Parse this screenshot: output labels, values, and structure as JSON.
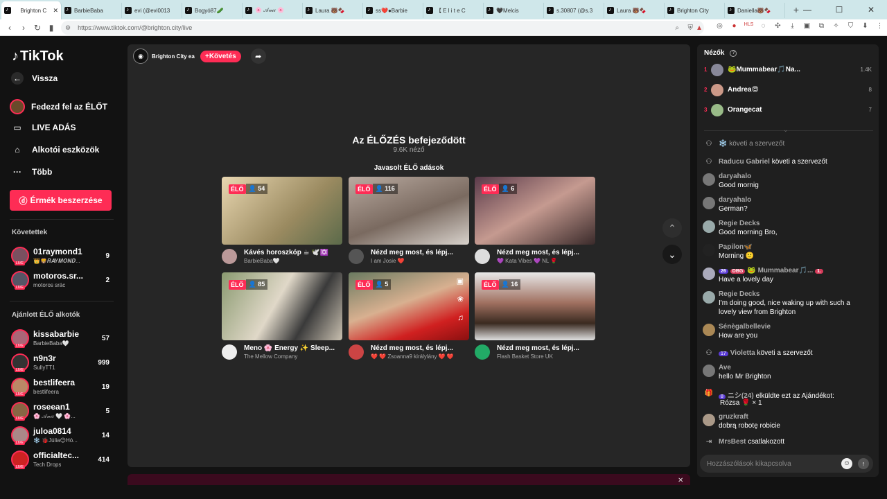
{
  "browser": {
    "tabs": [
      {
        "label": "Brighton C",
        "active": true
      },
      {
        "label": "BarbieBaba"
      },
      {
        "label": "evi (@evi0013"
      },
      {
        "label": "Bogyó87🥒"
      },
      {
        "label": "🌸 𝒜𝓃𝒾𝒾 🌸"
      },
      {
        "label": "Laura 🐻🍫"
      },
      {
        "label": "ss❤️●Barbie"
      },
      {
        "label": "【 E l i t e C"
      },
      {
        "label": "🖤Melcis"
      },
      {
        "label": "s.30807 (@s.3"
      },
      {
        "label": "Laura 🐻🍫"
      },
      {
        "label": "Brighton City"
      },
      {
        "label": "Daniella🐻🍫"
      }
    ],
    "url": "https://www.tiktok.com/@brighton.city/live",
    "new_tab": "+",
    "win_min": "—",
    "win_max": "☐",
    "win_close": "✕"
  },
  "sidebar": {
    "logo": "TikTok",
    "back": "Vissza",
    "nav": [
      {
        "label": "Fedezd fel az ÉLŐT",
        "icon": "explore-live-icon"
      },
      {
        "label": "LIVE ADÁS",
        "icon": "camera-icon"
      },
      {
        "label": "Alkotói eszközök",
        "icon": "creator-tools-icon"
      },
      {
        "label": "Több",
        "icon": "more-icon"
      }
    ],
    "coins_btn": "Érmék beszerzése",
    "following_title": "Követettek",
    "following": [
      {
        "name": "01raymond1",
        "sub": "👑🦁𝑹𝑨𝒀𝑴𝑶𝑵𝑫...",
        "count": "9"
      },
      {
        "name": "motoros.sr...",
        "sub": "motoros srác",
        "count": "2"
      }
    ],
    "recommended_title": "Ajánlott ÉLŐ alkotók",
    "recommended": [
      {
        "name": "kissabarbie",
        "sub": "BarbieBaba🤍",
        "count": "57"
      },
      {
        "name": "n9n3r",
        "sub": "SullyTT1",
        "count": "999"
      },
      {
        "name": "bestlifeera",
        "sub": "bestlifeera",
        "count": "19"
      },
      {
        "name": "roseean1",
        "sub": "🌸 𝒜𝓃𝒾𝒾 🤍 🌸...",
        "count": "5"
      },
      {
        "name": "juloa0814",
        "sub": "❄️ 🐞Júlia😊Hó...",
        "count": "14"
      },
      {
        "name": "officialtec...",
        "sub": "Tech Drops",
        "count": "414"
      }
    ]
  },
  "stream": {
    "host": "Brighton City ea",
    "follow": "+Követés",
    "ended_title": "Az ÉLŐZÉS befejeződött",
    "viewers": "9.6K néző",
    "suggested_title": "Javasolt ÉLŐ adások",
    "cards": [
      {
        "elo": "ÉLŐ",
        "viewers": "54",
        "title": "Kávés horoszkóp ☕ 🕊️✡️",
        "author": "BarbieBaba🤍"
      },
      {
        "elo": "ÉLŐ",
        "viewers": "116",
        "title": "Nézd meg most, és lépj...",
        "author": "I am Josie ❤️"
      },
      {
        "elo": "ÉLŐ",
        "viewers": "6",
        "title": "Nézd meg most, és lépj...",
        "author": "💜 Kata Vibes 💜 NL 🌹"
      },
      {
        "elo": "ÉLŐ",
        "viewers": "85",
        "title": "Meno 🌸 Energy ✨ Sleep...",
        "author": "The Mellow Company"
      },
      {
        "elo": "ÉLŐ",
        "viewers": "5",
        "title": "Nézd meg most, és lépj...",
        "author": "❤️ ❤️ Zsoanna9 királylány ❤️ ❤️"
      },
      {
        "elo": "ÉLŐ",
        "viewers": "16",
        "title": "Nézd meg most, és lépj...",
        "author": "Flash Basket Store UK"
      }
    ]
  },
  "panel": {
    "viewers_title": "Nézők",
    "top_viewers": [
      {
        "rank": "1",
        "name": "🐸Mummabear🎵Na...",
        "score": "1.4K"
      },
      {
        "rank": "2",
        "name": "Andrea😍",
        "score": "8"
      },
      {
        "rank": "3",
        "name": "Orangecat",
        "score": "7"
      }
    ],
    "messages": [
      {
        "type": "sys",
        "user": "❄️",
        "text": "követi a szervezőt"
      },
      {
        "type": "sys",
        "user": "Raducu Gabriel",
        "text": "követi a szervezőt"
      },
      {
        "type": "chat",
        "user": "daryahalo",
        "text": "Good mornig"
      },
      {
        "type": "chat",
        "user": "daryahalo",
        "text": "German?"
      },
      {
        "type": "chat",
        "user": "Regie Decks",
        "text": "Good morning Bro,"
      },
      {
        "type": "chat",
        "user": "Papilon🦋",
        "text": "Morning 🙂"
      },
      {
        "type": "chat",
        "user": "🐸 Mummabear🎵...",
        "text": "Have a lovely day",
        "level": "26",
        "level2": "DBG",
        "level3": "1."
      },
      {
        "type": "chat",
        "user": "Regie Decks",
        "text": "I'm doing good, nice waking up with such a",
        "text2": "lovely view from Brighton"
      },
      {
        "type": "chat",
        "user": "Sénègalbellevie",
        "text": "How are you"
      },
      {
        "type": "sys",
        "user": "Violetta",
        "text": "követi a szervezőt",
        "level": "17"
      },
      {
        "type": "chat",
        "user": "Ave",
        "text": "hello Mr Brighton"
      },
      {
        "type": "gift",
        "user": "ニシ(24)",
        "text": "elküldte ezt az Ajándékot:",
        "text2": "Rózsa 🌹 × 1",
        "level": "8"
      },
      {
        "type": "chat",
        "user": "gruzkraft",
        "text": "dobrą robotę robicie"
      },
      {
        "type": "sys",
        "user": "MrsBest",
        "text": "csatlakozott"
      }
    ],
    "input_placeholder": "Hozzászólások kikapcsolva"
  }
}
